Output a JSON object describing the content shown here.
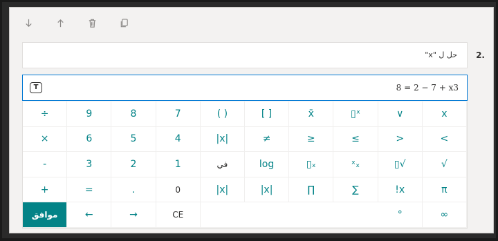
{
  "toolbar": {
    "icons": [
      "arrow-down-icon",
      "arrow-up-icon",
      "trash-icon",
      "copy-icon"
    ]
  },
  "question": {
    "number": "2.",
    "text": "حل ل \"x\""
  },
  "answer": {
    "format_icon_label": "T",
    "expression": "8 = 2 − 7 + x3"
  },
  "keypad": {
    "rows": [
      [
        "÷",
        "9",
        "8",
        "7",
        "( )",
        "[ ]",
        "x̄",
        "▯ˣ",
        "∨",
        "x"
      ],
      [
        "×",
        "6",
        "5",
        "4",
        "|x|",
        "≠",
        "≥",
        "≤",
        ">",
        "<"
      ],
      [
        "-",
        "3",
        "2",
        "1",
        "في",
        "log",
        "▯ₓ",
        "ˣₓ",
        "▯√",
        "√"
      ],
      [
        "+",
        "=",
        ".",
        "0",
        "|x|",
        "|x|",
        "∏",
        "∑",
        "!x",
        "π"
      ],
      [
        "موافق",
        "←",
        "→",
        "CE",
        "",
        "",
        "",
        "",
        "°",
        "∞"
      ]
    ]
  }
}
